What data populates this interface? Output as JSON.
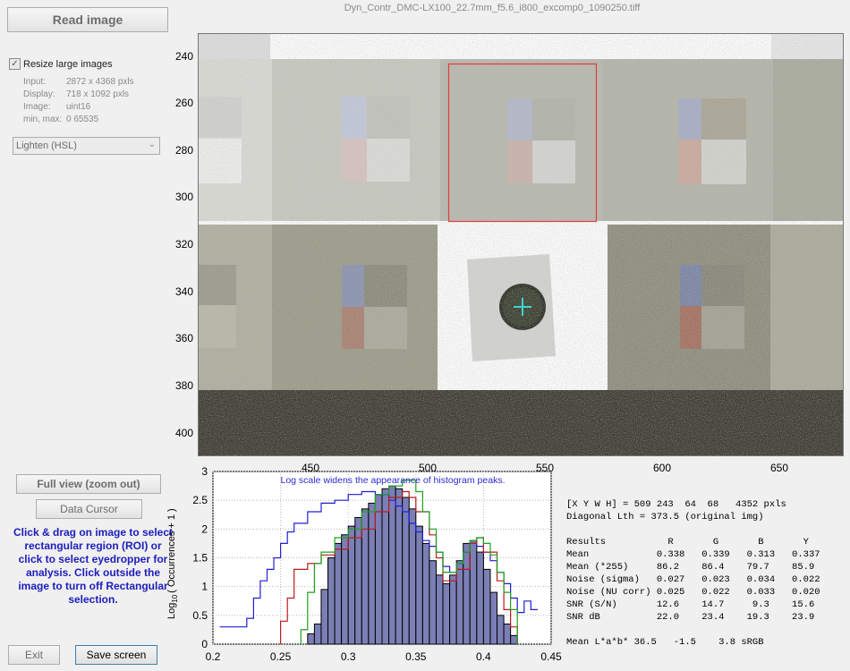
{
  "window": {
    "title": "Dyn_Contr_DMC-LX100_22.7mm_f5.6_i800_excomp0_1090250.tiff"
  },
  "left_panel": {
    "read_image_label": "Read image",
    "resize_checkbox": {
      "label": "Resize large images",
      "checked": true
    },
    "info": [
      {
        "key": "Input:",
        "value": "2872 x 4368 pxls"
      },
      {
        "key": "Display:",
        "value": "718 x 1092 pxls"
      },
      {
        "key": "Image:",
        "value": "uint16"
      },
      {
        "key": "min, max:",
        "value": "0  65535"
      }
    ],
    "display_mode_select": "Lighten (HSL)",
    "full_view_label": "Full view (zoom out)",
    "data_cursor_label": "Data Cursor",
    "instructions": "Click & drag on image to select rectangular region (ROI) or click to select eyedropper for analysis. Click outside the image to turn off Rectangular selection.",
    "exit_label": "Exit",
    "save_screen_label": "Save screen"
  },
  "image_axes": {
    "y_ticks": [
      "240",
      "260",
      "280",
      "300",
      "320",
      "340",
      "360",
      "380",
      "400"
    ],
    "x_ticks": [
      "450",
      "500",
      "550",
      "600",
      "650"
    ],
    "roi_color": "#e23b3b"
  },
  "histogram": {
    "note": "Log scale widens the appearance of histogram peaks.",
    "ylabel": "Log",
    "ylabel_sub": "10",
    "ylabel_rest": "( Occurrences + 1 )",
    "y_ticks": [
      "0",
      "0.5",
      "1",
      "1.5",
      "2",
      "2.5",
      "3"
    ],
    "x_ticks": [
      "0.2",
      "0.25",
      "0.3",
      "0.35",
      "0.4",
      "0.45"
    ]
  },
  "chart_data": {
    "type": "bar",
    "xlim": [
      0.2,
      0.45
    ],
    "ylim": [
      0,
      3
    ],
    "grid": true,
    "bar_color": "#7b7fb5",
    "bins": [
      0.2725,
      0.2775,
      0.2825,
      0.2875,
      0.2925,
      0.2975,
      0.3025,
      0.3075,
      0.3125,
      0.3175,
      0.3225,
      0.3275,
      0.3325,
      0.3375,
      0.3425,
      0.3475,
      0.3525,
      0.3575,
      0.3625,
      0.3675,
      0.3725,
      0.3775,
      0.3825,
      0.3875,
      0.3925,
      0.3975,
      0.4025,
      0.4075,
      0.4125,
      0.4175,
      0.4225
    ],
    "values": [
      0.18,
      0.35,
      0.95,
      1.5,
      1.75,
      1.9,
      2.05,
      2.2,
      2.35,
      2.45,
      2.6,
      2.7,
      2.75,
      2.7,
      2.55,
      2.35,
      2.05,
      1.75,
      1.45,
      1.2,
      1.05,
      1.2,
      1.45,
      1.75,
      1.8,
      1.6,
      1.3,
      0.9,
      0.5,
      0.35,
      0.15
    ],
    "series": [
      {
        "color": "#1f1fd6",
        "points": [
          [
            0.205,
            0.3
          ],
          [
            0.225,
            0.3
          ],
          [
            0.225,
            0.45
          ],
          [
            0.23,
            0.45
          ],
          [
            0.23,
            0.8
          ],
          [
            0.235,
            0.8
          ],
          [
            0.235,
            1.1
          ],
          [
            0.24,
            1.1
          ],
          [
            0.24,
            1.3
          ],
          [
            0.245,
            1.3
          ],
          [
            0.245,
            1.5
          ],
          [
            0.25,
            1.5
          ],
          [
            0.25,
            1.75
          ],
          [
            0.255,
            1.75
          ],
          [
            0.255,
            1.95
          ],
          [
            0.26,
            1.95
          ],
          [
            0.26,
            2.1
          ],
          [
            0.27,
            2.1
          ],
          [
            0.27,
            2.3
          ],
          [
            0.28,
            2.3
          ],
          [
            0.28,
            2.45
          ],
          [
            0.29,
            2.45
          ],
          [
            0.29,
            2.5
          ],
          [
            0.3,
            2.5
          ],
          [
            0.3,
            2.6
          ],
          [
            0.31,
            2.6
          ],
          [
            0.31,
            2.65
          ],
          [
            0.32,
            2.65
          ],
          [
            0.32,
            2.6
          ],
          [
            0.33,
            2.6
          ],
          [
            0.33,
            2.5
          ],
          [
            0.335,
            2.5
          ],
          [
            0.335,
            2.4
          ],
          [
            0.34,
            2.4
          ],
          [
            0.34,
            2.3
          ],
          [
            0.345,
            2.3
          ],
          [
            0.345,
            2.1
          ],
          [
            0.35,
            2.1
          ],
          [
            0.35,
            1.95
          ],
          [
            0.355,
            1.95
          ],
          [
            0.355,
            1.8
          ],
          [
            0.36,
            1.8
          ],
          [
            0.36,
            1.7
          ],
          [
            0.365,
            1.7
          ],
          [
            0.365,
            1.6
          ],
          [
            0.37,
            1.6
          ],
          [
            0.37,
            1.35
          ],
          [
            0.375,
            1.35
          ],
          [
            0.375,
            1.25
          ],
          [
            0.38,
            1.25
          ],
          [
            0.38,
            1.4
          ],
          [
            0.385,
            1.4
          ],
          [
            0.385,
            1.6
          ],
          [
            0.39,
            1.6
          ],
          [
            0.39,
            1.75
          ],
          [
            0.395,
            1.75
          ],
          [
            0.395,
            1.7
          ],
          [
            0.4,
            1.7
          ],
          [
            0.4,
            1.6
          ],
          [
            0.405,
            1.6
          ],
          [
            0.405,
            1.45
          ],
          [
            0.41,
            1.45
          ],
          [
            0.41,
            1.25
          ],
          [
            0.415,
            1.25
          ],
          [
            0.415,
            1.05
          ],
          [
            0.42,
            1.05
          ],
          [
            0.42,
            0.8
          ],
          [
            0.425,
            0.8
          ],
          [
            0.425,
            0.55
          ],
          [
            0.43,
            0.55
          ],
          [
            0.43,
            0.75
          ],
          [
            0.435,
            0.75
          ],
          [
            0.435,
            0.6
          ],
          [
            0.44,
            0.6
          ]
        ]
      },
      {
        "color": "#b71c1c",
        "points": [
          [
            0.25,
            0
          ],
          [
            0.25,
            0.4
          ],
          [
            0.255,
            0.4
          ],
          [
            0.255,
            0.8
          ],
          [
            0.26,
            0.8
          ],
          [
            0.26,
            1.3
          ],
          [
            0.27,
            1.3
          ],
          [
            0.27,
            1.4
          ],
          [
            0.28,
            1.4
          ],
          [
            0.28,
            1.55
          ],
          [
            0.29,
            1.55
          ],
          [
            0.29,
            1.65
          ],
          [
            0.3,
            1.65
          ],
          [
            0.3,
            1.85
          ],
          [
            0.31,
            1.85
          ],
          [
            0.31,
            2.0
          ],
          [
            0.32,
            2.0
          ],
          [
            0.32,
            2.3
          ],
          [
            0.33,
            2.3
          ],
          [
            0.33,
            2.55
          ],
          [
            0.34,
            2.55
          ],
          [
            0.34,
            2.65
          ],
          [
            0.345,
            2.65
          ],
          [
            0.345,
            2.55
          ],
          [
            0.35,
            2.55
          ],
          [
            0.35,
            2.3
          ],
          [
            0.36,
            2.3
          ],
          [
            0.36,
            1.9
          ],
          [
            0.365,
            1.9
          ],
          [
            0.365,
            1.5
          ],
          [
            0.37,
            1.5
          ],
          [
            0.37,
            1.1
          ],
          [
            0.38,
            1.1
          ],
          [
            0.38,
            1.3
          ],
          [
            0.39,
            1.3
          ],
          [
            0.39,
            1.75
          ],
          [
            0.395,
            1.75
          ],
          [
            0.395,
            1.85
          ],
          [
            0.4,
            1.85
          ],
          [
            0.4,
            1.6
          ],
          [
            0.41,
            1.6
          ],
          [
            0.41,
            1.1
          ],
          [
            0.415,
            1.1
          ],
          [
            0.415,
            0.6
          ],
          [
            0.42,
            0.6
          ],
          [
            0.42,
            0.3
          ],
          [
            0.425,
            0.3
          ],
          [
            0.425,
            0
          ]
        ]
      },
      {
        "color": "#1fa01f",
        "points": [
          [
            0.265,
            0
          ],
          [
            0.265,
            0.25
          ],
          [
            0.27,
            0.25
          ],
          [
            0.27,
            0.9
          ],
          [
            0.275,
            0.9
          ],
          [
            0.275,
            1.4
          ],
          [
            0.28,
            1.4
          ],
          [
            0.28,
            1.6
          ],
          [
            0.29,
            1.6
          ],
          [
            0.29,
            1.85
          ],
          [
            0.3,
            1.85
          ],
          [
            0.3,
            2.0
          ],
          [
            0.31,
            2.0
          ],
          [
            0.31,
            2.3
          ],
          [
            0.32,
            2.3
          ],
          [
            0.32,
            2.6
          ],
          [
            0.33,
            2.6
          ],
          [
            0.33,
            2.75
          ],
          [
            0.34,
            2.75
          ],
          [
            0.34,
            2.85
          ],
          [
            0.35,
            2.85
          ],
          [
            0.35,
            2.65
          ],
          [
            0.355,
            2.65
          ],
          [
            0.355,
            2.3
          ],
          [
            0.36,
            2.3
          ],
          [
            0.36,
            2.0
          ],
          [
            0.365,
            2.0
          ],
          [
            0.365,
            1.6
          ],
          [
            0.37,
            1.6
          ],
          [
            0.37,
            1.25
          ],
          [
            0.38,
            1.25
          ],
          [
            0.38,
            1.4
          ],
          [
            0.385,
            1.4
          ],
          [
            0.385,
            1.6
          ],
          [
            0.39,
            1.6
          ],
          [
            0.39,
            1.8
          ],
          [
            0.395,
            1.8
          ],
          [
            0.395,
            1.85
          ],
          [
            0.4,
            1.85
          ],
          [
            0.4,
            1.75
          ],
          [
            0.405,
            1.75
          ],
          [
            0.405,
            1.55
          ],
          [
            0.41,
            1.55
          ],
          [
            0.41,
            1.25
          ],
          [
            0.415,
            1.25
          ],
          [
            0.415,
            0.9
          ],
          [
            0.42,
            0.9
          ],
          [
            0.42,
            0.6
          ],
          [
            0.425,
            0.6
          ],
          [
            0.425,
            0
          ]
        ]
      }
    ]
  },
  "results": {
    "xywh": "[X Y W H] = 509 243  64  68   4352 pxls",
    "diagonal": "Diagonal Lth = 373.5 (original img)",
    "header": "Results           R       G       B       Y",
    "rows": [
      "Mean            0.338   0.339   0.313   0.337",
      "Mean (*255)     86.2    86.4    79.7    85.9",
      "Noise (sigma)   0.027   0.023   0.034   0.022",
      "Noise (NU corr) 0.025   0.022   0.033   0.020",
      "SNR (S/N)       12.6    14.7     9.3    15.6",
      "SNR dB          22.0    23.4    19.3    23.9"
    ],
    "lab": "Mean L*a*b* 36.5   -1.5    3.8 sRGB"
  }
}
